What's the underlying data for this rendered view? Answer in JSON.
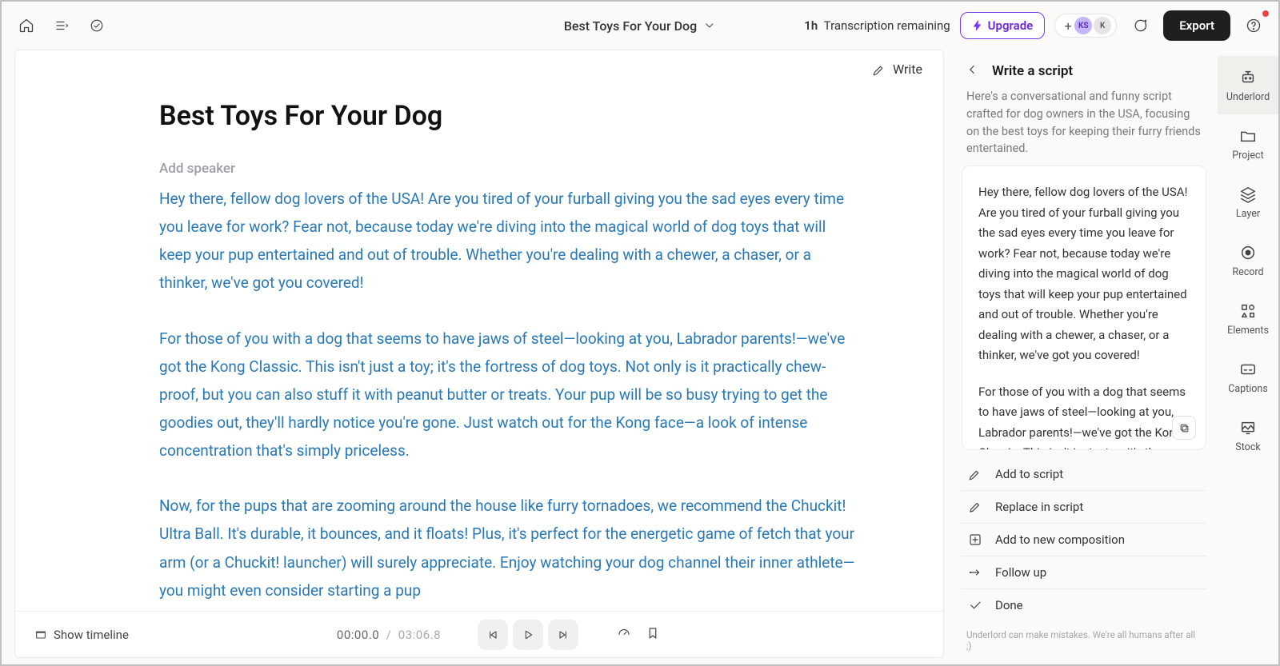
{
  "header": {
    "title": "Best Toys For Your Dog",
    "transcription_hours": "1h",
    "transcription_label": "Transcription remaining",
    "upgrade": "Upgrade",
    "export": "Export",
    "avatar1": "KS",
    "avatar2": "K"
  },
  "editor": {
    "write_label": "Write",
    "doc_title": "Best Toys For Your Dog",
    "add_speaker": "Add speaker",
    "paragraphs": [
      "Hey there, fellow dog lovers of the USA! Are you tired of your furball giving you the sad eyes every time you leave for work? Fear not, because today we're diving into the magical world of dog toys that will keep your pup entertained and out of trouble. Whether you're dealing with a chewer, a chaser, or a thinker, we've got you covered!",
      "For those of you with a dog that seems to have jaws of steel—looking at you, Labrador parents!—we've got the Kong Classic. This isn't just a toy; it's the fortress of dog toys. Not only is it practically chew-proof, but you can also stuff it with peanut butter or treats. Your pup will be so busy trying to get the goodies out, they'll hardly notice you're gone. Just watch out for the Kong face—a look of intense concentration that's simply priceless.",
      "Now, for the pups that are zooming around the house like furry tornadoes, we recommend the Chuckit! Ultra Ball. It's durable, it bounces, and it floats! Plus, it's perfect for the energetic game of fetch that your arm (or a Chuckit! launcher) will surely appreciate. Enjoy watching your dog channel their inner athlete—you might even consider starting a pup"
    ]
  },
  "footer": {
    "show_timeline": "Show timeline",
    "time_current": "00:00.0",
    "time_total": "03:06.8"
  },
  "inspector": {
    "title": "Write a script",
    "intro": "Here's a conversational and funny script crafted for dog owners in the USA, focusing on the best toys for keeping their furry friends entertained.",
    "script_p1": "Hey there, fellow dog lovers of the USA! Are you tired of your furball giving you the sad eyes every time you leave for work? Fear not, because today we're diving into the magical world of dog toys that will keep your pup entertained and out of trouble. Whether you're dealing with a chewer, a chaser, or a thinker, we've got you covered!",
    "script_p2": "For those of you with a dog that seems to have jaws of steel—looking at you, Labrador parents!—we've got the Kong Classic. This isn't just a toy; it's the",
    "actions": {
      "add": "Add to script",
      "replace": "Replace in script",
      "new_comp": "Add to new composition",
      "follow": "Follow up",
      "done": "Done"
    },
    "disclaimer": "Underlord can make mistakes. We're all humans after all ;)"
  },
  "rail": {
    "underlord": "Underlord",
    "project": "Project",
    "layer": "Layer",
    "record": "Record",
    "elements": "Elements",
    "captions": "Captions",
    "stock": "Stock"
  }
}
